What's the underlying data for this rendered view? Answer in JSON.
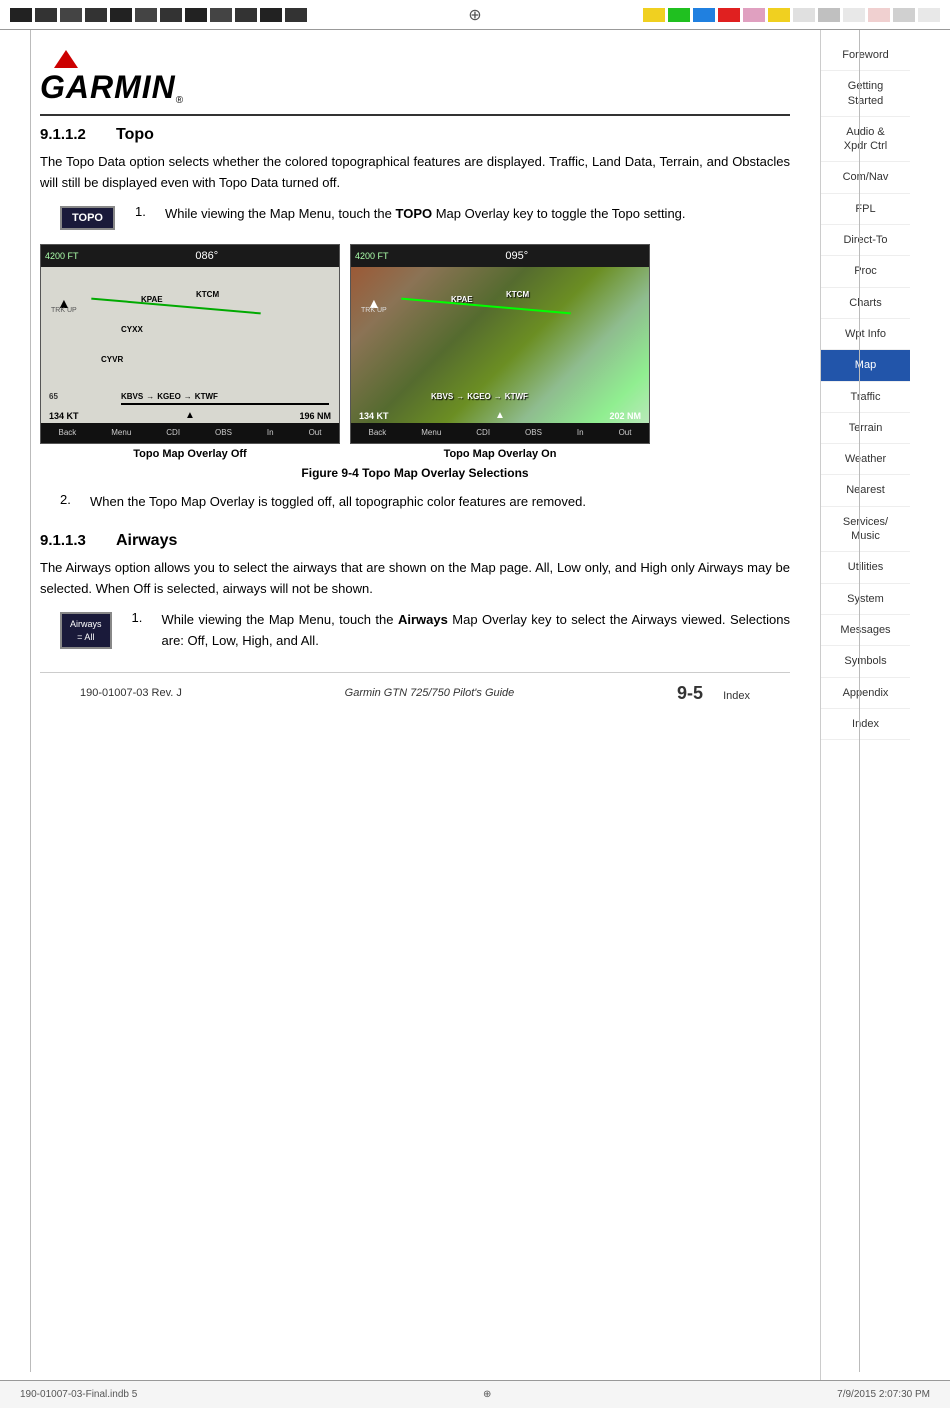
{
  "topBar": {
    "leftBlocks": [
      1,
      2,
      3,
      4,
      5,
      6,
      7,
      8,
      9,
      10,
      11,
      12
    ],
    "centerSymbol": "⊕",
    "rightColors": [
      "#f0d020",
      "#20c020",
      "#2080e0",
      "#e02020",
      "#e0a0c0",
      "#f0d020",
      "#20c020",
      "#2080e0",
      "#e02020",
      "#e0a0c0",
      "#e0e0e0",
      "#c0c0c0"
    ]
  },
  "logo": {
    "brand": "GARMIN",
    "reg": "®"
  },
  "section": {
    "number": "9.1.1.2",
    "title": "Topo",
    "body1": "The Topo Data option selects whether the colored topographical features are displayed. Traffic, Land Data, Terrain, and Obstacles will still be displayed even with Topo Data turned off.",
    "step1Num": "1.",
    "step1Text": "While viewing the Map Menu, touch the ",
    "step1Bold": "TOPO",
    "step1TextEnd": " Map Overlay key to toggle the Topo setting.",
    "topoButton": "TOPO",
    "mapOff": {
      "altitude": "4200 FT",
      "heading": "086°",
      "distance": "196 NM",
      "scale": "65",
      "wp1": "KPAE",
      "wp2": "KTCM",
      "wp3": "CYXX",
      "wp4": "CYVR",
      "wp5": "KBVS",
      "wp6": "KGEO",
      "wp7": "KTWF",
      "dist_label": "134 KT"
    },
    "mapOn": {
      "altitude": "4200 FT",
      "heading": "095°",
      "distance": "202 NM",
      "wp1": "KPAE",
      "wp2": "KTCM",
      "wp3": "KBVS",
      "wp4": "KGEO",
      "wp5": "KTWF",
      "dist_label": "134 KT"
    },
    "captionOff": "Topo Map Overlay Off",
    "captionOn": "Topo Map Overlay On",
    "figureCaption": "Figure 9-4  Topo Map Overlay Selections",
    "step2Num": "2.",
    "step2Text": "When the Topo Map Overlay is toggled off, all topographic color features are removed."
  },
  "section2": {
    "number": "9.1.1.3",
    "title": "Airways",
    "body1": "The Airways option allows you to select the airways that are shown on the Map page. All, Low only, and High only Airways may be selected. When Off is selected, airways will not be shown.",
    "step1Num": "1.",
    "step1Text": "While viewing the Map Menu, touch the ",
    "step1Bold": "Airways",
    "step1TextEnd": " Map Overlay key to select the Airways viewed. Selections are: Off, Low, High, and All.",
    "airwaysButton1": "Airways",
    "airwaysButton2": "= All"
  },
  "sidebar": {
    "items": [
      {
        "label": "Foreword",
        "active": false
      },
      {
        "label": "Getting\nStarted",
        "active": false
      },
      {
        "label": "Audio &\nXpdr Ctrl",
        "active": false
      },
      {
        "label": "Com/Nav",
        "active": false
      },
      {
        "label": "FPL",
        "active": false
      },
      {
        "label": "Direct-To",
        "active": false
      },
      {
        "label": "Proc",
        "active": false
      },
      {
        "label": "Charts",
        "active": false
      },
      {
        "label": "Wpt Info",
        "active": false
      },
      {
        "label": "Map",
        "active": true
      },
      {
        "label": "Traffic",
        "active": false
      },
      {
        "label": "Terrain",
        "active": false
      },
      {
        "label": "Weather",
        "active": false
      },
      {
        "label": "Nearest",
        "active": false
      },
      {
        "label": "Services/\nMusic",
        "active": false
      },
      {
        "label": "Utilities",
        "active": false
      },
      {
        "label": "System",
        "active": false
      },
      {
        "label": "Messages",
        "active": false
      },
      {
        "label": "Symbols",
        "active": false
      },
      {
        "label": "Appendix",
        "active": false
      },
      {
        "label": "Index",
        "active": false
      }
    ]
  },
  "footer": {
    "left": "190-01007-03  Rev. J",
    "center": "Garmin GTN 725/750 Pilot's Guide",
    "right": "9-5",
    "rightLabel": "Index"
  },
  "bottomBar": {
    "left": "190-01007-03-Final.indb  5",
    "centerSymbol": "⊕",
    "right": "7/9/2015  2:07:30 PM"
  }
}
